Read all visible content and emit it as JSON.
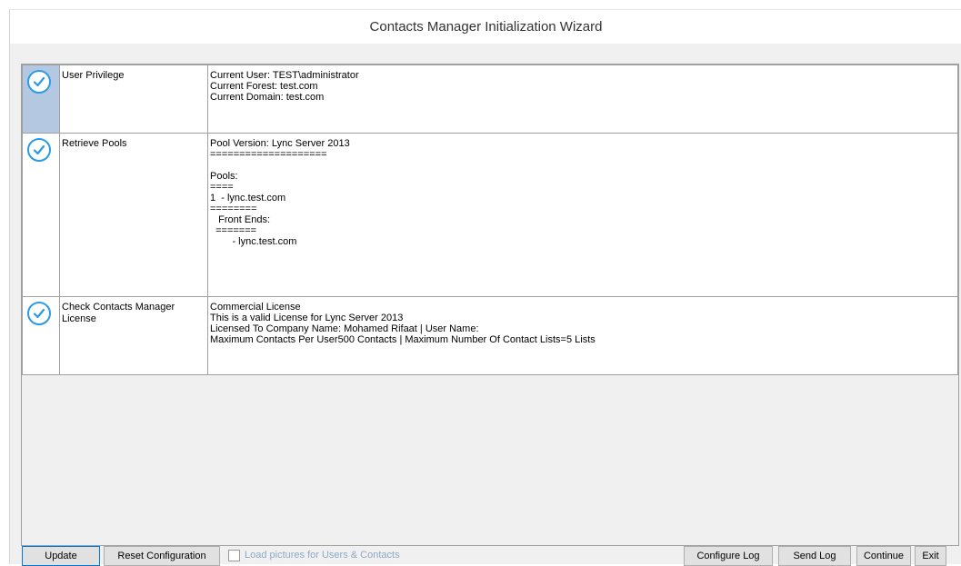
{
  "window": {
    "title": "Contacts Manager Initialization Wizard"
  },
  "steps": [
    {
      "status_icon": "check-circle-icon",
      "name": "User Privilege",
      "details": "Current User: TEST\\administrator\nCurrent Forest: test.com\nCurrent Domain: test.com",
      "selected": true
    },
    {
      "status_icon": "check-circle-icon",
      "name": "Retrieve Pools",
      "details": "Pool Version: Lync Server 2013\n====================\n\nPools:\n====\n1  - lync.test.com\n========\n   Front Ends:\n  =======\n        - lync.test.com",
      "selected": false
    },
    {
      "status_icon": "check-circle-icon",
      "name": "Check Contacts Manager License",
      "details": "Commercial License\nThis is a valid License for Lync Server 2013\nLicensed To Company Name: Mohamed Rifaat | User Name:\nMaximum Contacts Per User500 Contacts | Maximum Number Of Contact Lists=5 Lists",
      "selected": false
    }
  ],
  "footer": {
    "update_label": "Update",
    "reset_label": "Reset Configuration",
    "load_pictures_label": "Load pictures for Users & Contacts",
    "load_pictures_checked": false,
    "configure_log_label": "Configure Log",
    "send_log_label": "Send Log",
    "continue_label": "Continue",
    "exit_label": "Exit"
  },
  "colors": {
    "check_accent": "#2b9be3",
    "selected_row": "#b5c8e2",
    "disabled_text": "#8ca9c9"
  }
}
